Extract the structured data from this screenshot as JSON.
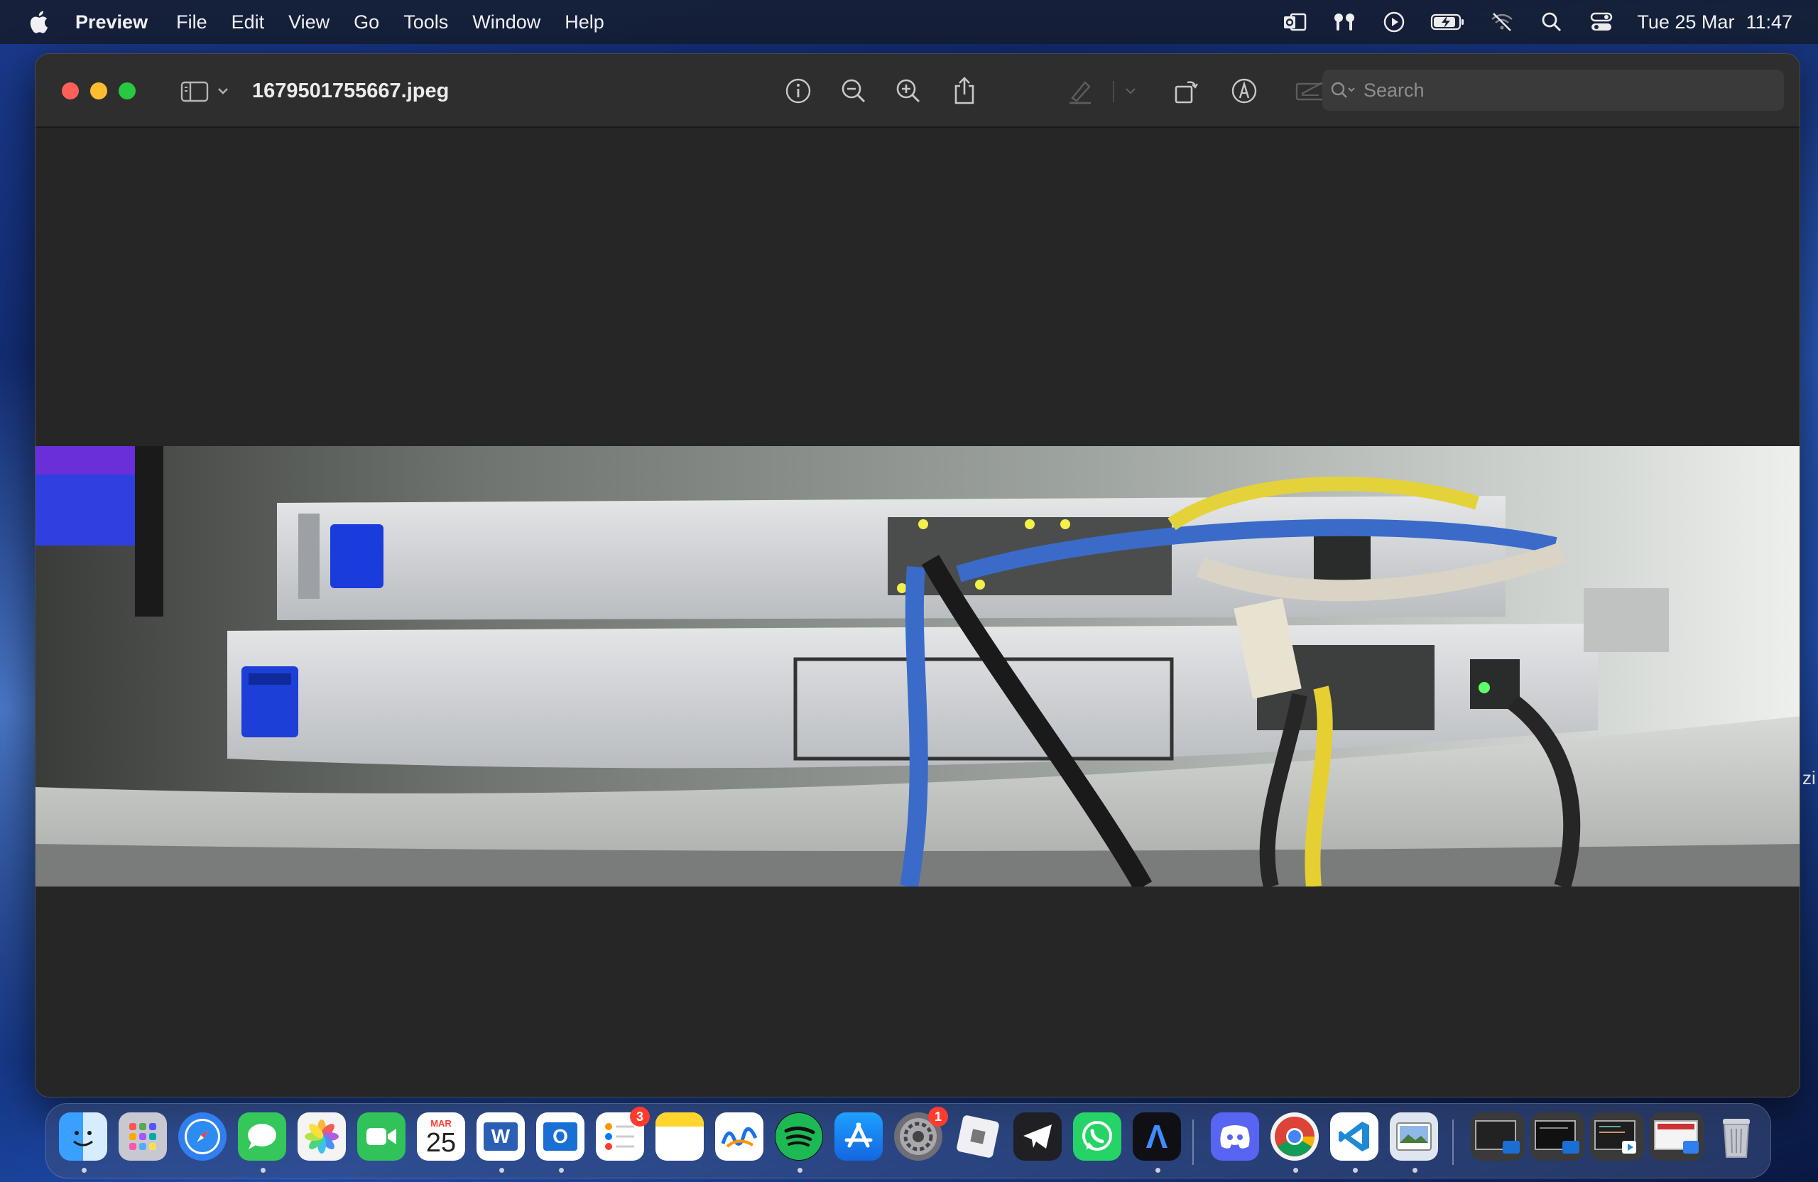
{
  "menubar": {
    "app_name": "Preview",
    "items": [
      "File",
      "Edit",
      "View",
      "Go",
      "Tools",
      "Window",
      "Help"
    ],
    "status_icons": [
      "outlook-icon",
      "airpods-icon",
      "play-icon",
      "battery-charging-icon",
      "wifi-off-icon",
      "spotlight-search-icon",
      "control-center-icon"
    ],
    "date": "Tue 25 Mar",
    "time": "11:47"
  },
  "window": {
    "title": "1679501755667.jpeg",
    "search_placeholder": "Search"
  },
  "dock": {
    "apps": [
      {
        "name": "Finder",
        "icon": "finder-icon",
        "color": "#2f8ff5",
        "running": true
      },
      {
        "name": "Launchpad",
        "icon": "launchpad-icon",
        "color": "#c8c8d0",
        "running": false
      },
      {
        "name": "Safari",
        "icon": "safari-icon",
        "color": "#2f7ff0",
        "running": false
      },
      {
        "name": "Messages",
        "icon": "messages-icon",
        "color": "#35c759",
        "running": true
      },
      {
        "name": "Photos",
        "icon": "photos-icon",
        "color": "#f4f4f4",
        "running": false
      },
      {
        "name": "FaceTime",
        "icon": "facetime-icon",
        "color": "#32c25a",
        "running": false
      },
      {
        "name": "Calendar",
        "icon": "calendar-icon",
        "color": "#ffffff",
        "month": "MAR",
        "day": "25",
        "running": false
      },
      {
        "name": "Word",
        "icon": "word-icon",
        "color": "#2b5fb5",
        "label": "W",
        "running": true
      },
      {
        "name": "Outlook",
        "icon": "outlook-icon",
        "color": "#1a6fd4",
        "label": "O",
        "running": true
      },
      {
        "name": "Reminders",
        "icon": "reminders-icon",
        "color": "#ffffff",
        "badge": "3",
        "running": false
      },
      {
        "name": "Notes",
        "icon": "notes-icon",
        "color": "#ffe066",
        "running": false
      },
      {
        "name": "Freeform",
        "icon": "freeform-icon",
        "color": "#ffffff",
        "running": false
      },
      {
        "name": "Spotify",
        "icon": "spotify-icon",
        "color": "#1db954",
        "running": true
      },
      {
        "name": "App Store",
        "icon": "app-store-icon",
        "color": "#1e8cf5",
        "running": false
      },
      {
        "name": "System Settings",
        "icon": "system-settings-icon",
        "color": "#8a8a90",
        "badge": "1",
        "running": false
      },
      {
        "name": "Linear",
        "icon": "linear-icon",
        "color": "#e8e8ec",
        "running": false
      },
      {
        "name": "Telegram",
        "icon": "telegram-icon",
        "color": "#1f1f24",
        "running": false
      },
      {
        "name": "WhatsApp",
        "icon": "whatsapp-icon",
        "color": "#25d366",
        "running": false
      },
      {
        "name": "Arc",
        "icon": "arc-icon",
        "color": "#101014",
        "label": "Λ",
        "running": true
      },
      {
        "name": "Discord",
        "icon": "discord-icon",
        "color": "#5865f2",
        "running": false
      },
      {
        "name": "Chrome",
        "icon": "chrome-icon",
        "color": "#ffffff",
        "running": true
      },
      {
        "name": "VS Code",
        "icon": "vscode-icon",
        "color": "#ffffff",
        "running": true
      },
      {
        "name": "Preview",
        "icon": "preview-icon",
        "color": "#dfe6f0",
        "running": true
      }
    ],
    "recent_windows": [
      "recent-window-1",
      "recent-window-2",
      "recent-window-3",
      "recent-window-4"
    ],
    "trash": {
      "name": "Trash",
      "icon": "trash-icon"
    }
  },
  "edge_text": "zi"
}
